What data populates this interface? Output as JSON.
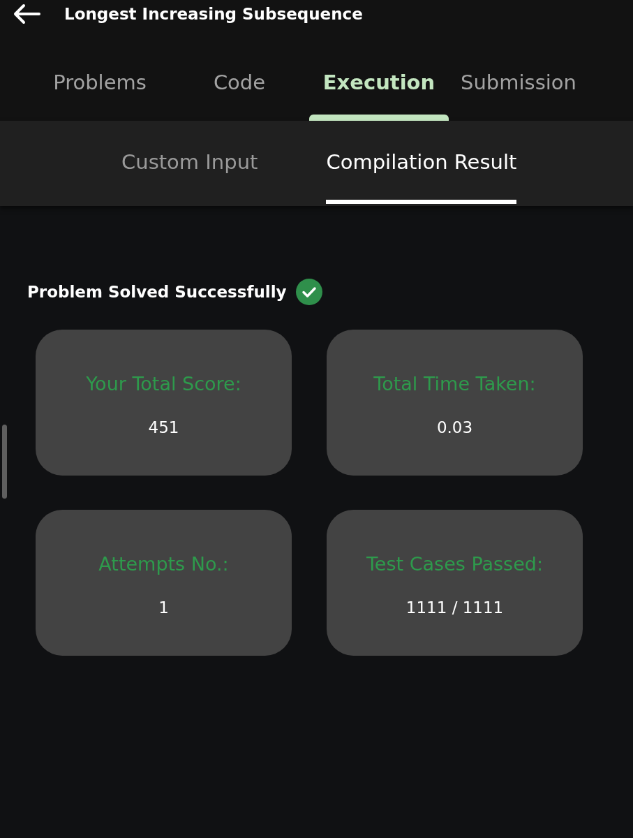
{
  "header": {
    "title": "Longest Increasing Subsequence"
  },
  "tabs": [
    {
      "label": "Problems",
      "selected": false
    },
    {
      "label": "Code",
      "selected": false
    },
    {
      "label": "Execution",
      "selected": true
    },
    {
      "label": "Submission",
      "selected": false
    }
  ],
  "subtabs": [
    {
      "label": "Custom Input",
      "selected": false
    },
    {
      "label": "Compilation Result",
      "selected": true
    }
  ],
  "status": {
    "message": "Problem Solved Successfully"
  },
  "stats": [
    {
      "label": "Your Total Score:",
      "value": "451"
    },
    {
      "label": "Total Time Taken:",
      "value": "0.03"
    },
    {
      "label": "Attempts No.:",
      "value": "1"
    },
    {
      "label": "Test Cases Passed:",
      "value": "1111 / 1111"
    }
  ]
}
